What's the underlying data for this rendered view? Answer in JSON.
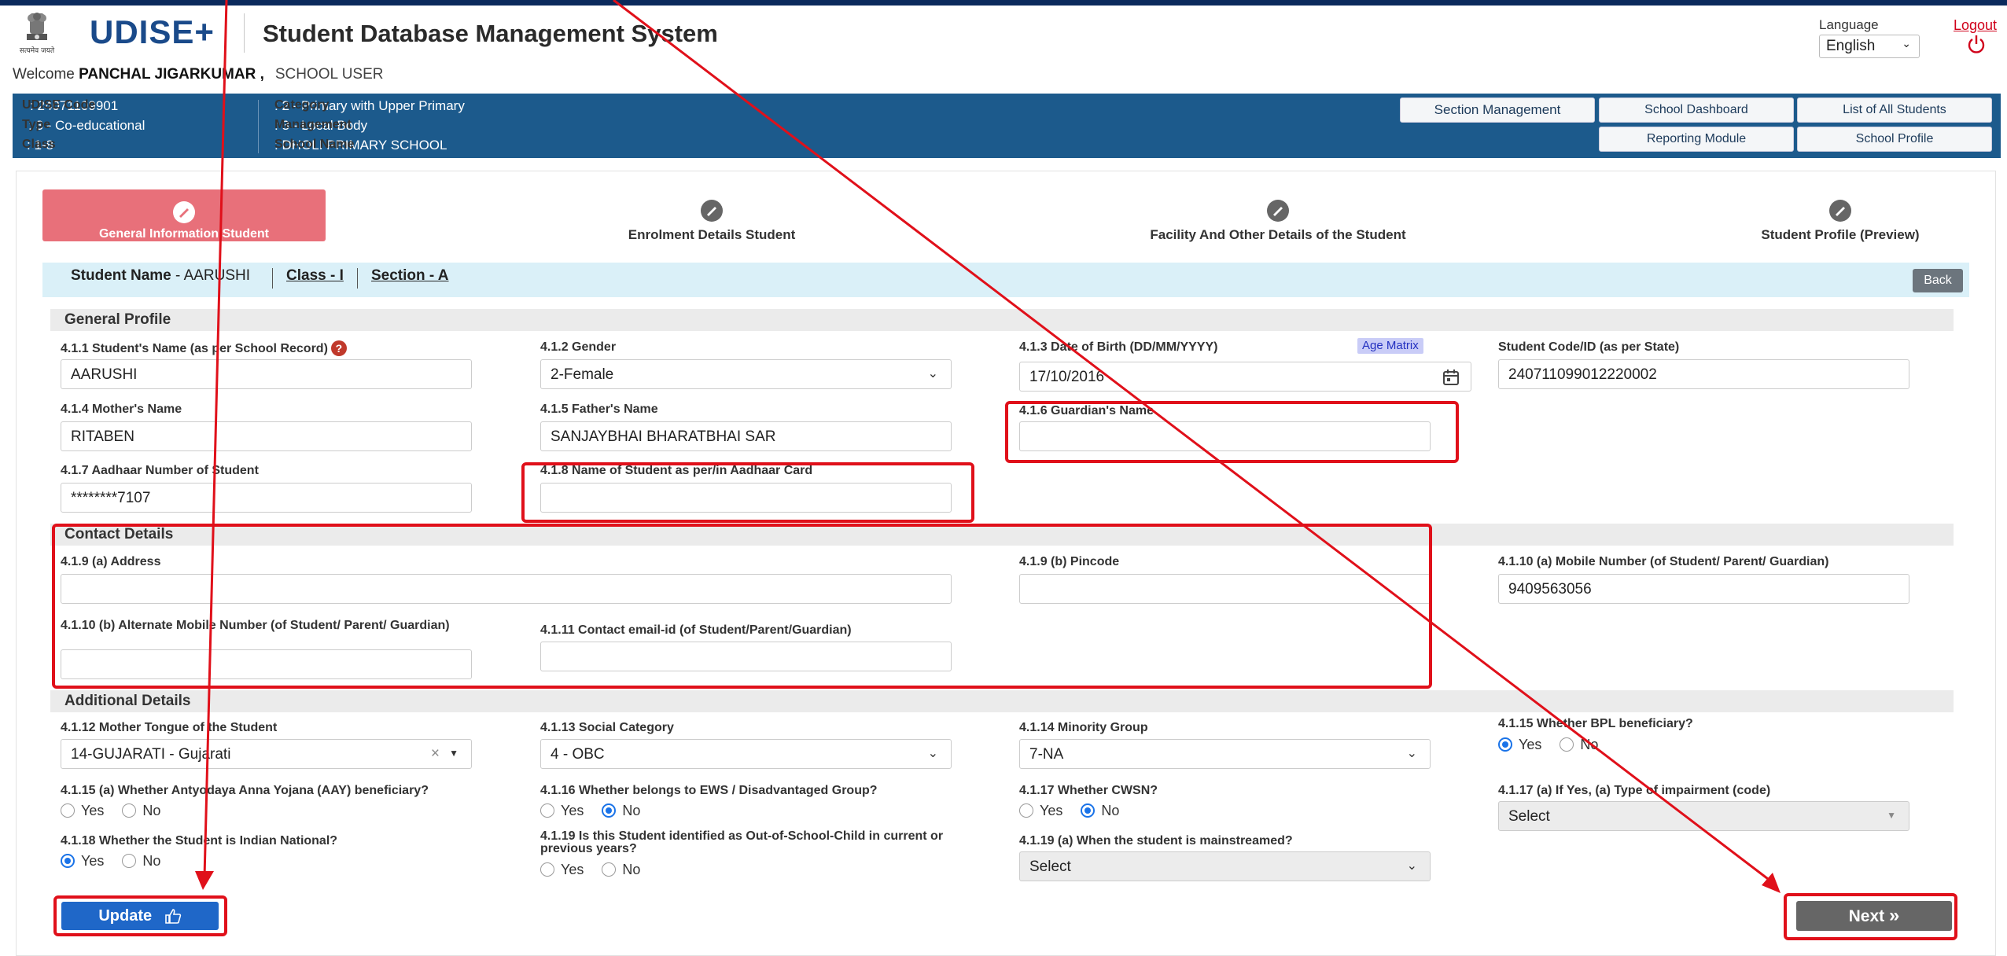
{
  "header": {
    "logo_text": "UDISE",
    "logo_plus": "+",
    "app_title": "Student Database Management System",
    "emblem_caption": "सत्यमेव जयते",
    "language_label": "Language",
    "language_value": "English",
    "logout_label": "Logout"
  },
  "welcome": {
    "prefix": "Welcome",
    "user": "PANCHAL JIGARKUMAR ,",
    "role": "SCHOOL USER"
  },
  "school": {
    "udise_code_label": "UDISE Code",
    "udise_code": ": 24071109901",
    "type_label": "Type",
    "type": ": 3 - Co-educational",
    "class_label": "Class",
    "class": ": 1-8",
    "category_label": "Category",
    "category": ": 2 - Primary with Upper Primary",
    "management_label": "Management",
    "management": ": 3 - Local Body",
    "school_name_label": "School Name",
    "school_name": ": DHOLI PRIMARY SCHOOL"
  },
  "top_buttons": {
    "section_management": "Section Management",
    "school_dashboard": "School Dashboard",
    "list_students": "List of All Students",
    "reporting_module": "Reporting Module",
    "school_profile": "School Profile"
  },
  "steps": [
    {
      "label": "General Information Student"
    },
    {
      "label": "Enrolment Details Student"
    },
    {
      "label": "Facility And Other Details of the Student"
    },
    {
      "label": "Student Profile (Preview)"
    }
  ],
  "student_bar": {
    "name_label": "Student Name",
    "name_value": "- AARUSHI",
    "class_label": "Class - I",
    "section_label": "Section - A",
    "back_label": "Back"
  },
  "sections": {
    "general": "General Profile",
    "contact": "Contact Details",
    "additional": "Additional Details"
  },
  "fields": {
    "student_name": {
      "label": "4.1.1 Student's Name (as per School Record)",
      "value": "AARUSHI"
    },
    "gender": {
      "label": "4.1.2 Gender",
      "value": "2-Female"
    },
    "dob": {
      "label": "4.1.3 Date of Birth (DD/MM/YYYY)",
      "value": "17/10/2016",
      "age_matrix": "Age Matrix"
    },
    "student_code": {
      "label": "Student Code/ID (as per State)",
      "value": "240711099012220002"
    },
    "mother_name": {
      "label": "4.1.4 Mother's Name",
      "value": "RITABEN"
    },
    "father_name": {
      "label": "4.1.5 Father's Name",
      "value": "SANJAYBHAI BHARATBHAI SAR"
    },
    "guardian_name": {
      "label": "4.1.6 Guardian's Name",
      "value": ""
    },
    "aadhaar_number": {
      "label": "4.1.7 Aadhaar Number of Student",
      "value": "********7107"
    },
    "aadhaar_name": {
      "label": "4.1.8 Name of Student as per/in Aadhaar Card",
      "value": ""
    },
    "address": {
      "label": "4.1.9 (a) Address",
      "value": ""
    },
    "pincode": {
      "label": "4.1.9 (b) Pincode",
      "value": ""
    },
    "mobile": {
      "label": "4.1.10 (a) Mobile Number (of Student/ Parent/ Guardian)",
      "value": "9409563056"
    },
    "alt_mobile": {
      "label": "4.1.10 (b) Alternate Mobile Number (of Student/ Parent/ Guardian)",
      "value": ""
    },
    "email": {
      "label": "4.1.11 Contact email-id (of Student/Parent/Guardian)",
      "value": ""
    },
    "mother_tongue": {
      "label": "4.1.12 Mother Tongue of the Student",
      "value": "14-GUJARATI - Gujarati",
      "clear": "×"
    },
    "social_category": {
      "label": "4.1.13 Social Category",
      "value": "4 - OBC"
    },
    "minority_group": {
      "label": "4.1.14 Minority Group",
      "value": "7-NA"
    },
    "bpl": {
      "label": "4.1.15 Whether BPL beneficiary?",
      "selected": "Yes"
    },
    "aay": {
      "label": "4.1.15 (a) Whether Antyodaya Anna Yojana (AAY) beneficiary?",
      "selected": ""
    },
    "ews": {
      "label": "4.1.16 Whether belongs to EWS / Disadvantaged Group?",
      "selected": "No"
    },
    "cwsn": {
      "label": "4.1.17 Whether CWSN?",
      "selected": "No"
    },
    "impairment": {
      "label": "4.1.17 (a) If Yes, (a) Type of impairment (code)",
      "value": "Select"
    },
    "indian_national": {
      "label": "4.1.18 Whether the Student is Indian National?",
      "selected": "Yes"
    },
    "oosc": {
      "label": "4.1.19 Is this Student identified as Out-of-School-Child in current or previous years?",
      "selected": ""
    },
    "mainstreamed": {
      "label": "4.1.19 (a) When the student is mainstreamed?",
      "value": "Select"
    }
  },
  "radio_labels": {
    "yes": "Yes",
    "no": "No"
  },
  "actions": {
    "update": "Update",
    "next": "Next"
  },
  "colors": {
    "header_band": "#1c5a8c",
    "active_step": "#e8707a",
    "primary": "#1f67c8",
    "annotation": "#e0101a"
  }
}
